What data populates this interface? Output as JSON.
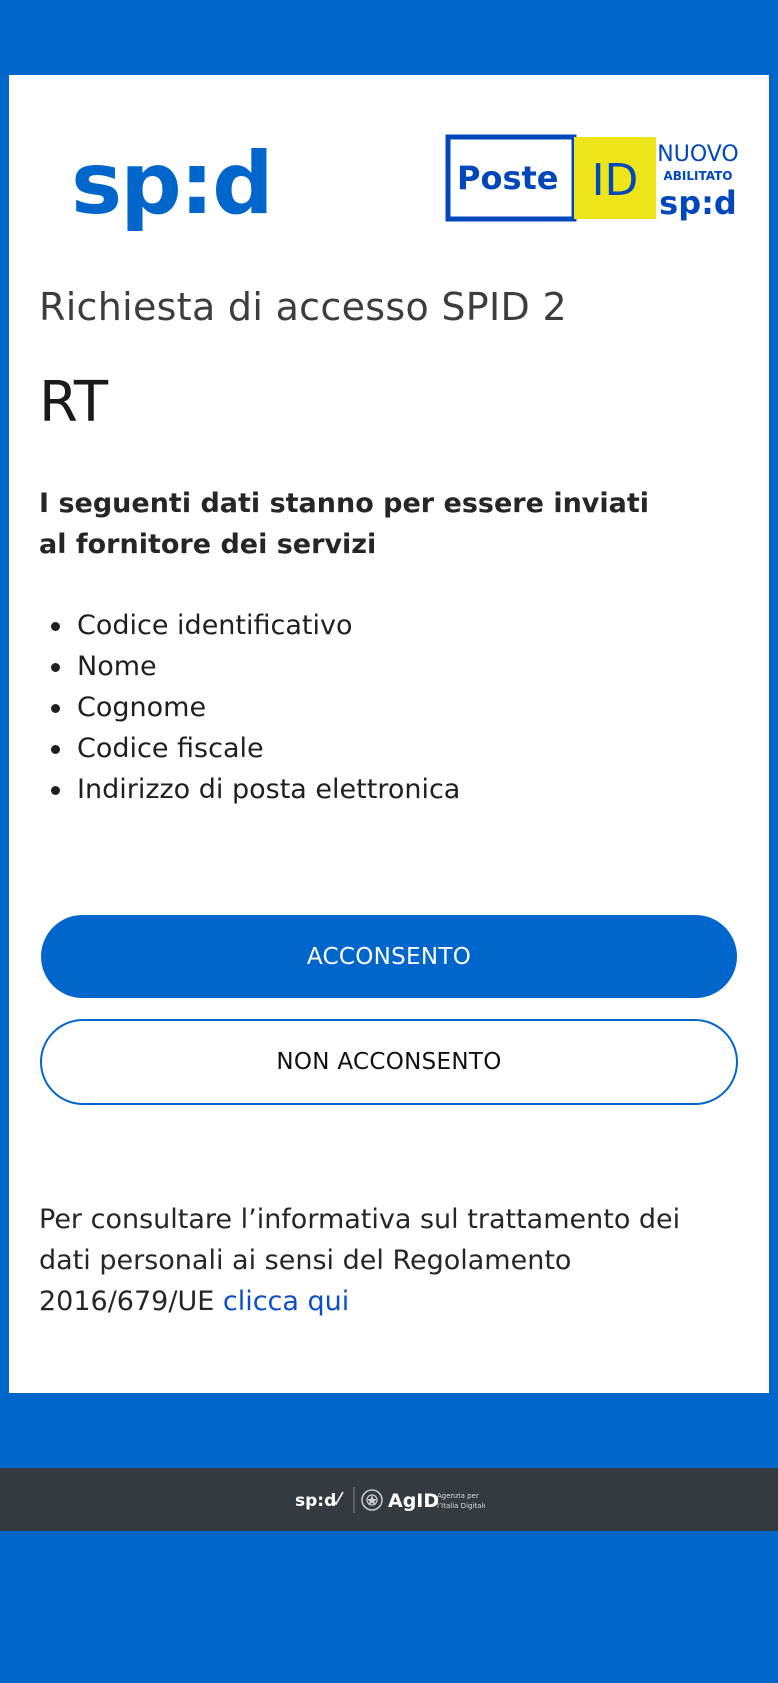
{
  "header": {
    "spid_logo_text": "sp:d",
    "poste_logo": {
      "brand": "Poste",
      "id": "ID",
      "badge_top": "NUOVO",
      "badge_middle": "ABILITATO",
      "badge_bottom": "sp:d"
    }
  },
  "main": {
    "title": "Richiesta di accesso SPID 2",
    "service_provider": "RT",
    "intro": "I seguenti dati stanno per essere inviati al fornitore dei servizi",
    "attributes": [
      "Codice identificativo",
      "Nome",
      "Cognome",
      "Codice fiscale",
      "Indirizzo di posta elettronica"
    ],
    "accept_label": "ACCONSENTO",
    "reject_label": "NON ACCONSENTO",
    "privacy_text": "Per consultare l’informativa sul trattamento dei dati personali ai sensi del Regolamento 2016/679/UE ",
    "privacy_link": "clicca qui"
  },
  "footer": {
    "spid_text": "sp:d",
    "agid_text": "AgID",
    "agid_caption_1": "Agenzia per",
    "agid_caption_2": "l’Italia Digitale"
  },
  "colors": {
    "primary": "#0066cc",
    "footer_bg": "#343a40",
    "poste_yellow": "#ede51a",
    "poste_blue": "#0047bb",
    "link": "#0b4fc8"
  }
}
